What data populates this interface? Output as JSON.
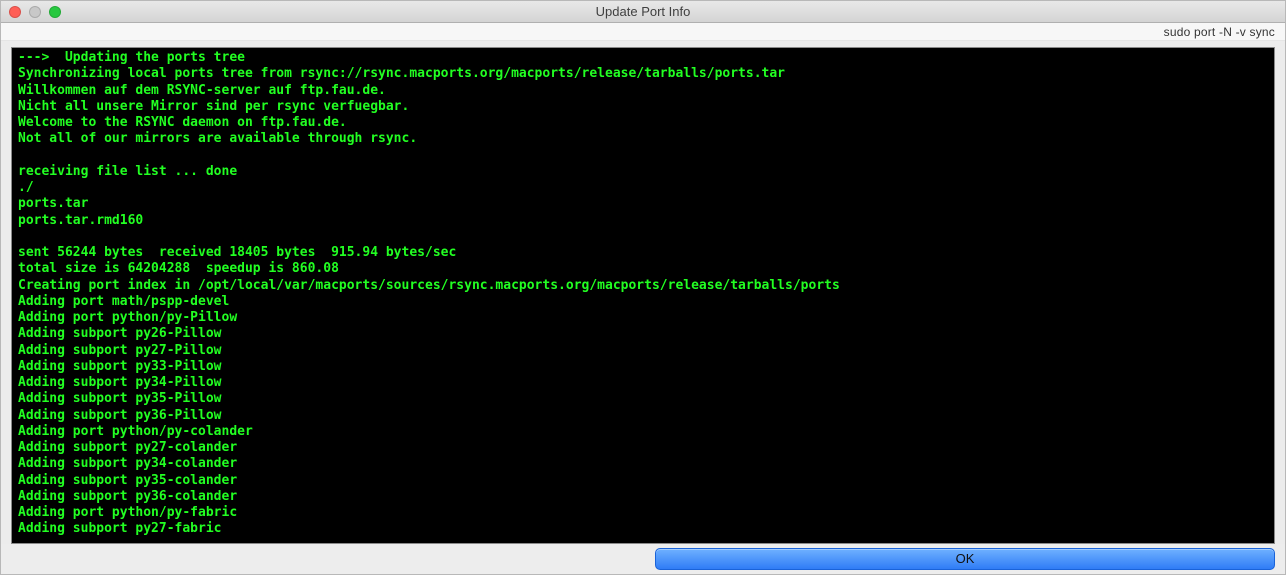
{
  "window": {
    "title": "Update Port Info"
  },
  "info": {
    "command": "sudo port -N -v sync"
  },
  "terminal": {
    "lines": [
      "--->  Updating the ports tree",
      "Synchronizing local ports tree from rsync://rsync.macports.org/macports/release/tarballs/ports.tar",
      "Willkommen auf dem RSYNC-server auf ftp.fau.de.",
      "Nicht all unsere Mirror sind per rsync verfuegbar.",
      "Welcome to the RSYNC daemon on ftp.fau.de.",
      "Not all of our mirrors are available through rsync.",
      "",
      "receiving file list ... done",
      "./",
      "ports.tar",
      "ports.tar.rmd160",
      "",
      "sent 56244 bytes  received 18405 bytes  915.94 bytes/sec",
      "total size is 64204288  speedup is 860.08",
      "Creating port index in /opt/local/var/macports/sources/rsync.macports.org/macports/release/tarballs/ports",
      "Adding port math/pspp-devel",
      "Adding port python/py-Pillow",
      "Adding subport py26-Pillow",
      "Adding subport py27-Pillow",
      "Adding subport py33-Pillow",
      "Adding subport py34-Pillow",
      "Adding subport py35-Pillow",
      "Adding subport py36-Pillow",
      "Adding port python/py-colander",
      "Adding subport py27-colander",
      "Adding subport py34-colander",
      "Adding subport py35-colander",
      "Adding subport py36-colander",
      "Adding port python/py-fabric",
      "Adding subport py27-fabric"
    ]
  },
  "buttons": {
    "ok_label": "OK"
  },
  "colors": {
    "terminal_bg": "#000000",
    "terminal_fg": "#22ff22",
    "button_gradient_top": "#6fb1ff",
    "button_gradient_bottom": "#2f7cf6"
  }
}
